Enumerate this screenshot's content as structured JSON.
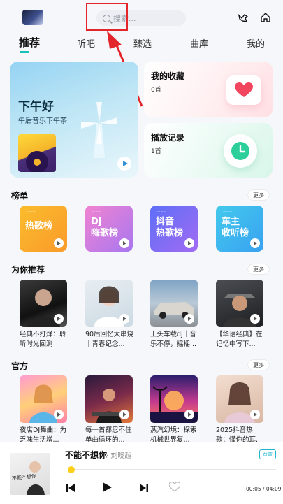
{
  "search": {
    "placeholder": "搜索..."
  },
  "tabs": [
    {
      "label": "推荐",
      "active": true
    },
    {
      "label": "听吧"
    },
    {
      "label": "臻选"
    },
    {
      "label": "曲库"
    },
    {
      "label": "我的"
    }
  ],
  "banner": {
    "title": "下午好",
    "subtitle": "午后音乐下午茶"
  },
  "favorites": {
    "title": "我的收藏",
    "count": "0首"
  },
  "history": {
    "title": "播放记录",
    "count": "1首"
  },
  "charts_section": {
    "title": "榜单",
    "more": "更多",
    "items": [
      {
        "line1": "热歌榜",
        "line2": "",
        "color_from": "#fbbd2c",
        "color_to": "#f99a2b"
      },
      {
        "line1": "DJ",
        "line2": "嗨歌榜",
        "color_from": "#f183d1",
        "color_to": "#a877f0"
      },
      {
        "line1": "抖音",
        "line2": "热歌榜",
        "color_from": "#5d6ff7",
        "color_to": "#a26bf3"
      },
      {
        "line1": "车主",
        "line2": "收听榜",
        "color_from": "#43c9ec",
        "color_to": "#39a2f2"
      }
    ]
  },
  "recommend_section": {
    "title": "为你推荐",
    "more": "更多",
    "items": [
      {
        "caption": "经典不打烊：聆听时光回测"
      },
      {
        "caption": "90后回忆大串烧｜青春纪念..."
      },
      {
        "caption": "上头车载dj｜音乐不停，摇摇..."
      },
      {
        "caption": "【华语经典】在记忆中写下..."
      }
    ]
  },
  "official_section": {
    "title": "官方",
    "more": "更多",
    "items": [
      {
        "caption": "夜店DJ舞曲：为乏味生活增..."
      },
      {
        "caption": "每一首都忍不住单曲循环的..."
      },
      {
        "caption": "蒸汽幻境：探索机械世界复..."
      },
      {
        "caption": "2025抖音热歌：懂你的耳..."
      }
    ]
  },
  "player": {
    "title": "不能不想你",
    "artist": "· 刘晓超",
    "badge": "音效",
    "time": "00:05 / 04:09",
    "cover_text": "不能不想你",
    "progress": 0.02
  },
  "colors": {
    "accent": "#16c2b7",
    "highlight": "#e3262b",
    "progress_knob": "#ffcf1a"
  }
}
